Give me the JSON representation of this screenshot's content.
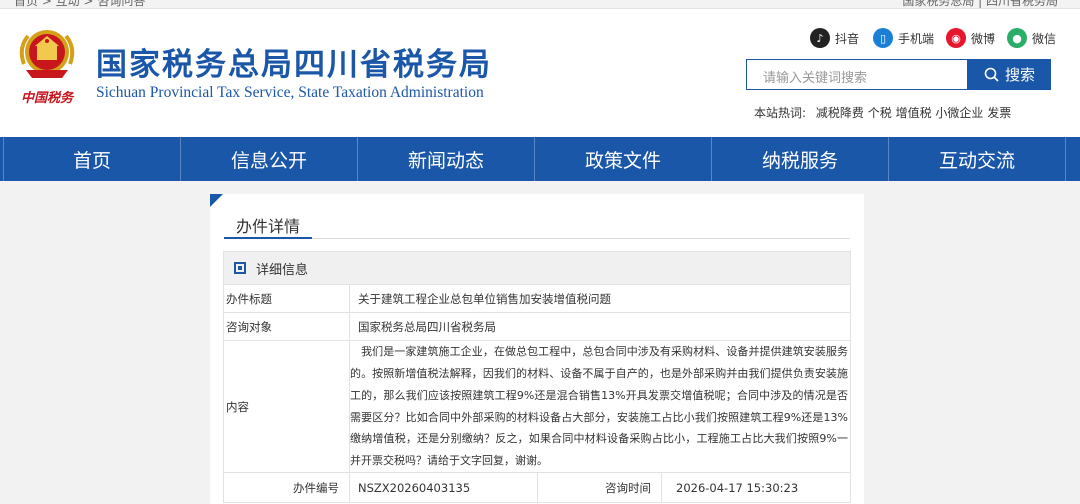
{
  "topbar": {
    "left_text": "首页 > 互动 > 咨询问答",
    "right_text": "国家税务总局 | 四川省税务局"
  },
  "header": {
    "title": "国家税务总局四川省税务局",
    "subtitle": "Sichuan Provincial Tax Service, State Taxation Administration",
    "logo_caption": "中国税务",
    "social": [
      {
        "label": "抖音",
        "icon": "douyin-icon",
        "color": "#222222"
      },
      {
        "label": "手机端",
        "icon": "mobile-icon",
        "color": "#1b7fd6"
      },
      {
        "label": "微博",
        "icon": "weibo-icon",
        "color": "#e6162d"
      },
      {
        "label": "微信",
        "icon": "wechat-icon",
        "color": "#2aae67"
      }
    ],
    "search": {
      "placeholder": "请输入关键词搜索",
      "button": "搜索"
    },
    "hotwords": {
      "label": "本站热词:",
      "words": [
        "减税降费",
        "个税",
        "增值税",
        "小微企业",
        "发票"
      ]
    }
  },
  "nav": {
    "items": [
      "首页",
      "信息公开",
      "新闻动态",
      "政策文件",
      "纳税服务",
      "互动交流"
    ]
  },
  "panel": {
    "title": "办件详情",
    "detail_header": "详细信息",
    "rows": {
      "subject_label": "办件标题",
      "subject": "关于建筑工程企业总包单位销售加安装增值税问题",
      "target_label": "咨询对象",
      "target": "国家税务总局四川省税务局",
      "content_label": "内容",
      "content": "　我们是一家建筑施工企业，在做总包工程中，总包合同中涉及有采购材料、设备并提供建筑安装服务的。按照新增值税法解释，因我们的材料、设备不属于自产的，也是外部采购并由我们提供负责安装施工的，那么我们应该按照建筑工程9%还是混合销售13%开具发票交增值税呢；合同中涉及的情况是否需要区分？比如合同中外部采购的材料设备占大部分，安装施工占比小我们按照建筑工程9%还是13%缴纳增值税，还是分别缴纳？反之，如果合同中材料设备采购占比小，工程施工占比大我们按照9%一并开票交税吗？请给于文字回复，谢谢。",
      "number_label": "办件编号",
      "number": "NSZX20260403135",
      "time_label": "咨询时间",
      "time": "2026-04-17 15:30:23"
    }
  },
  "colors": {
    "brand": "#1b57a8",
    "page_bg": "#f2f2f2"
  }
}
